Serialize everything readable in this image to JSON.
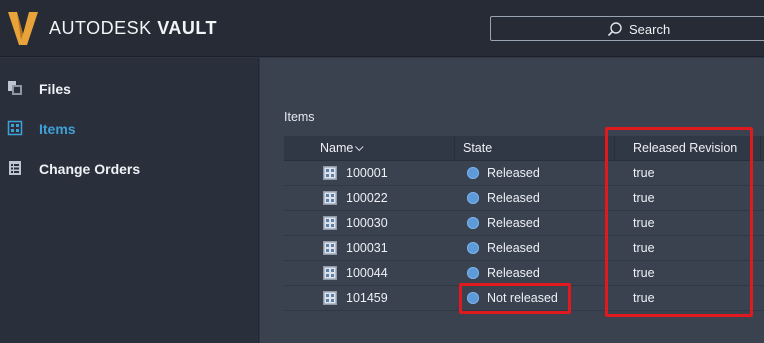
{
  "app": {
    "brand_thin": "AUTODESK",
    "brand_bold": "VAULT",
    "logo_color": "#e8a33a"
  },
  "search": {
    "label": "Search"
  },
  "sidebar": {
    "items": [
      {
        "label": "Files",
        "icon": "files-icon",
        "active": false
      },
      {
        "label": "Items",
        "icon": "items-icon",
        "active": true
      },
      {
        "label": "Change Orders",
        "icon": "change-orders-icon",
        "active": false
      }
    ]
  },
  "main": {
    "section_title": "Items",
    "columns": {
      "name": "Name",
      "state": "State",
      "released_revision": "Released Revision"
    },
    "rows": [
      {
        "name": "100001",
        "state": "Released",
        "released_revision": "true"
      },
      {
        "name": "100022",
        "state": "Released",
        "released_revision": "true"
      },
      {
        "name": "100030",
        "state": "Released",
        "released_revision": "true"
      },
      {
        "name": "100031",
        "state": "Released",
        "released_revision": "true"
      },
      {
        "name": "100044",
        "state": "Released",
        "released_revision": "true"
      },
      {
        "name": "101459",
        "state": "Not released",
        "released_revision": "true"
      }
    ]
  },
  "colors": {
    "accent": "#3fa0d8",
    "highlight": "#e0191f",
    "state_dot": "#5d9ad9"
  }
}
